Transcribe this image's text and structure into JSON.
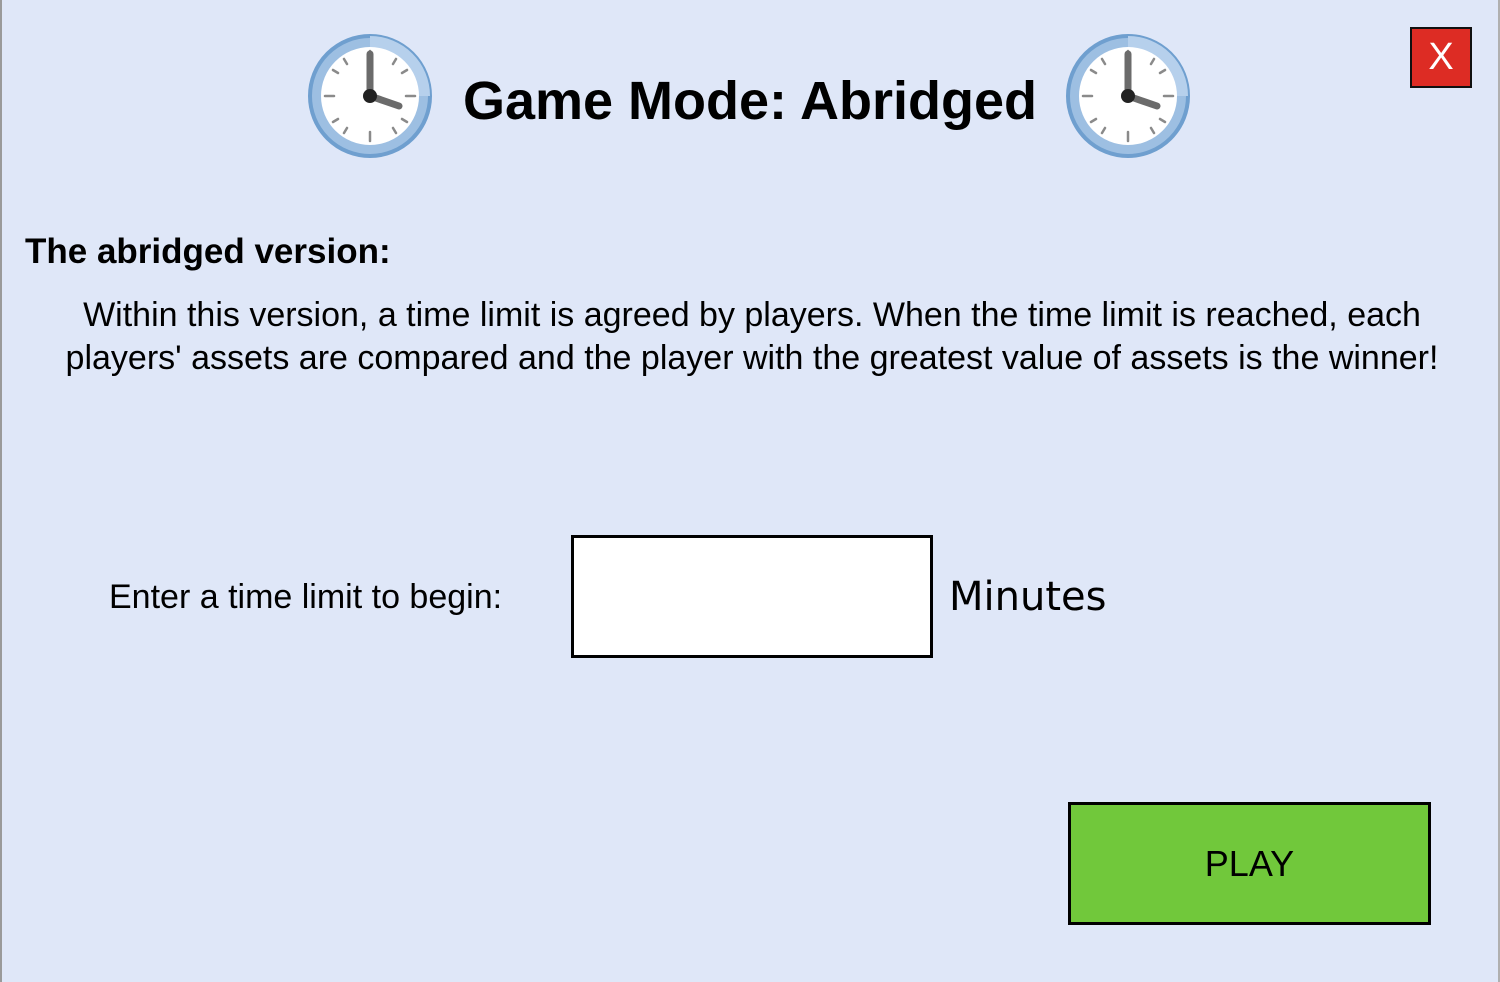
{
  "dialog": {
    "title": "Game Mode: Abridged",
    "header_icon": "clock-icon",
    "close_label": "X"
  },
  "content": {
    "heading": "The abridged version:",
    "description": "Within this version, a time limit is agreed by players. When the time limit is reached, each players' assets are compared and the player with the greatest value of assets is the winner!"
  },
  "time_limit": {
    "label": "Enter a time limit to begin:",
    "value": "",
    "units": "Minutes"
  },
  "actions": {
    "play_label": "PLAY"
  },
  "colors": {
    "background": "#dfe7f8",
    "close_button": "#dd2c24",
    "play_button": "#71c83b",
    "clock_rim": "#7ba8d6"
  }
}
